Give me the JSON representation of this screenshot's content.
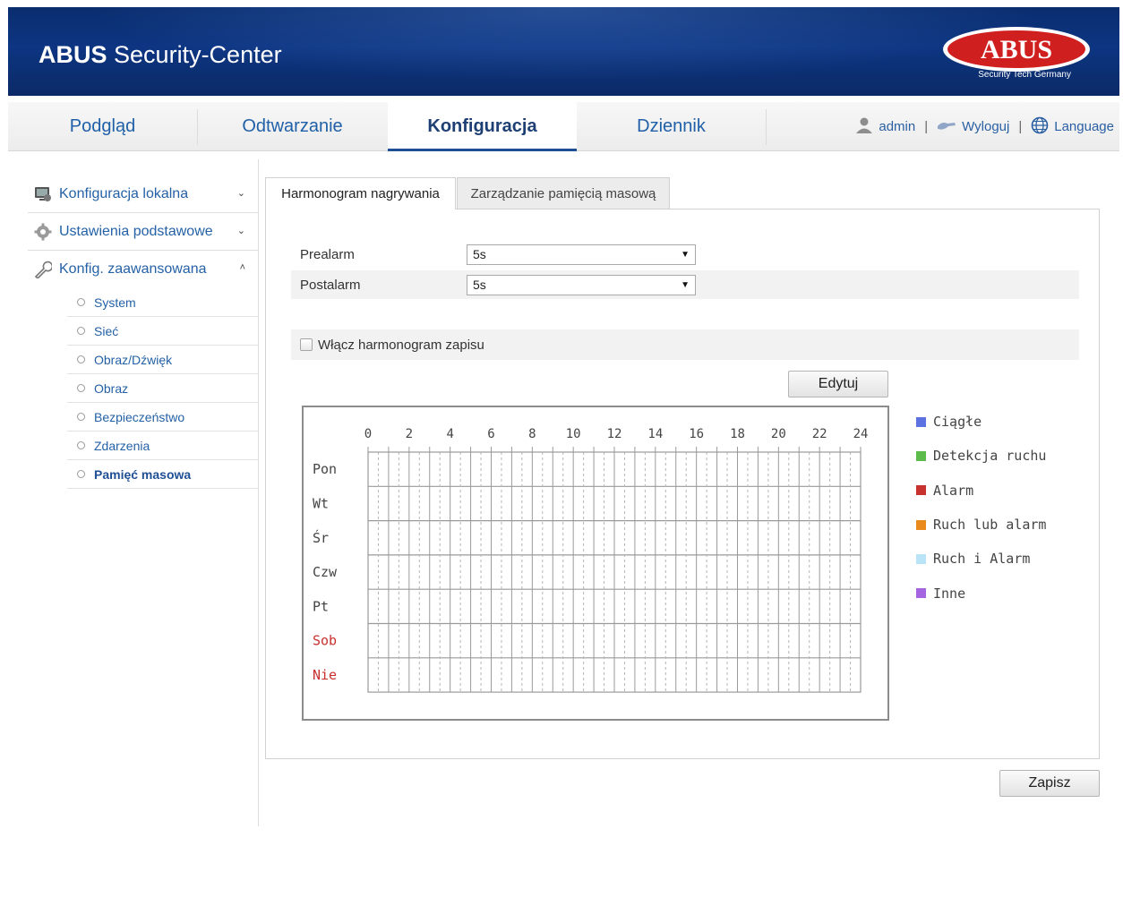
{
  "header": {
    "title_bold": "ABUS",
    "title_rest": "Security-Center",
    "logo_text": "ABUS",
    "logo_tagline": "Security Tech Germany"
  },
  "nav": {
    "tabs": [
      {
        "label": "Podgląd",
        "active": false
      },
      {
        "label": "Odtwarzanie",
        "active": false
      },
      {
        "label": "Konfiguracja",
        "active": true
      },
      {
        "label": "Dziennik",
        "active": false
      }
    ],
    "user": "admin",
    "logout": "Wyloguj",
    "language": "Language"
  },
  "sidebar": {
    "groups": [
      {
        "label": "Konfiguracja lokalna",
        "icon": "local-config-icon",
        "chevron": "⌄"
      },
      {
        "label": "Ustawienia podstawowe",
        "icon": "basic-settings-icon",
        "chevron": "⌄"
      },
      {
        "label": "Konfig. zaawansowana",
        "icon": "wrench-icon",
        "chevron": "˄"
      }
    ],
    "items": [
      {
        "label": "System"
      },
      {
        "label": "Sieć"
      },
      {
        "label": "Obraz/Dźwięk"
      },
      {
        "label": "Obraz"
      },
      {
        "label": "Bezpieczeństwo"
      },
      {
        "label": "Zdarzenia"
      },
      {
        "label": "Pamięć masowa",
        "active": true
      }
    ]
  },
  "tabs": [
    {
      "label": "Harmonogram nagrywania",
      "active": true
    },
    {
      "label": "Zarządzanie pamięcią masową",
      "active": false
    }
  ],
  "form": {
    "prealarm_label": "Prealarm",
    "prealarm_value": "5s",
    "postalarm_label": "Postalarm",
    "postalarm_value": "5s",
    "enable_label": "Włącz harmonogram zapisu",
    "edit_button": "Edytuj",
    "save_button": "Zapisz"
  },
  "schedule": {
    "hours": [
      "0",
      "2",
      "4",
      "6",
      "8",
      "10",
      "12",
      "14",
      "16",
      "18",
      "20",
      "22",
      "24"
    ],
    "days": [
      {
        "label": "Pon",
        "weekend": false
      },
      {
        "label": "Wt",
        "weekend": false
      },
      {
        "label": "Śr",
        "weekend": false
      },
      {
        "label": "Czw",
        "weekend": false
      },
      {
        "label": "Pt",
        "weekend": false
      },
      {
        "label": "Sob",
        "weekend": true
      },
      {
        "label": "Nie",
        "weekend": true
      }
    ],
    "weekend_color": "#c8302e"
  },
  "legend": [
    {
      "label": "Ciągłe",
      "color": "#5b72e0"
    },
    {
      "label": "Detekcja ruchu",
      "color": "#5dbb4c"
    },
    {
      "label": "Alarm",
      "color": "#c8322e"
    },
    {
      "label": "Ruch lub alarm",
      "color": "#e88b1c"
    },
    {
      "label": "Ruch i Alarm",
      "color": "#b9e3f7"
    },
    {
      "label": "Inne",
      "color": "#a665e0"
    }
  ]
}
